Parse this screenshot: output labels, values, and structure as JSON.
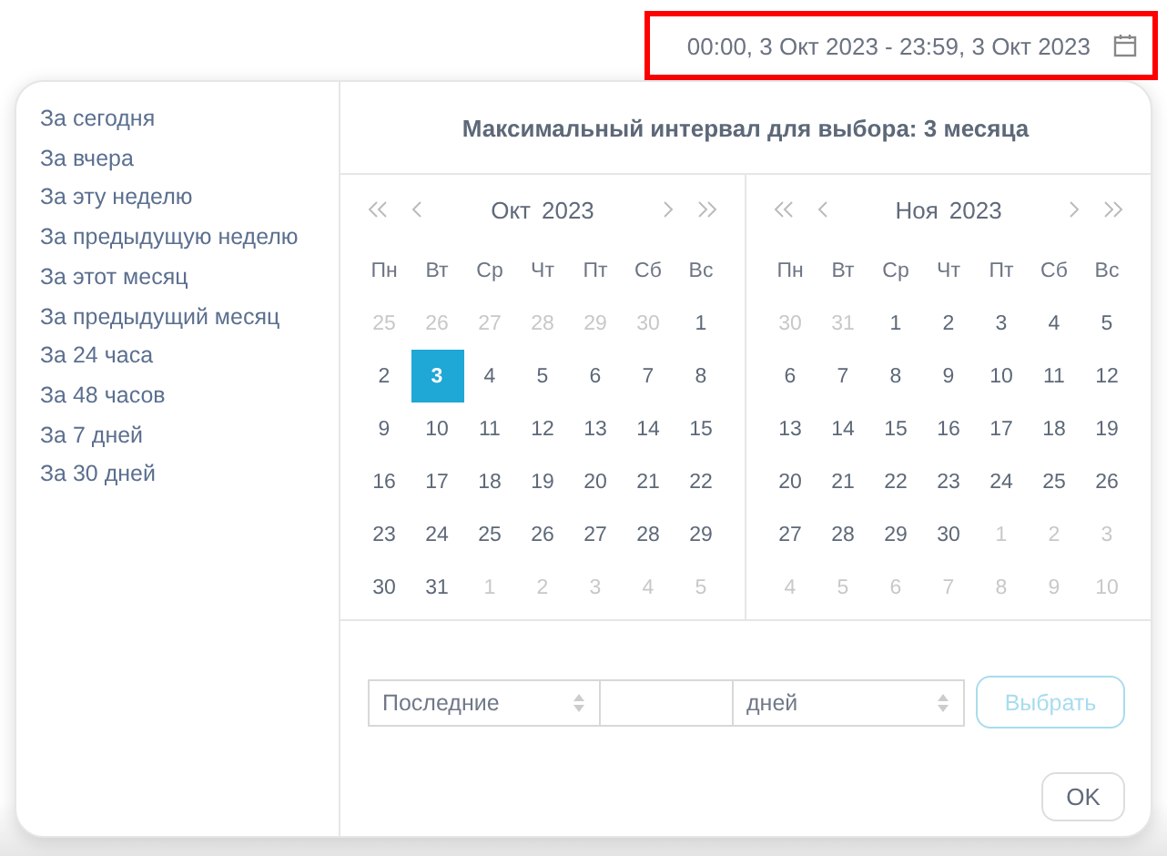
{
  "date_field": {
    "value": "00:00, 3 Окт 2023 - 23:59, 3 Окт 2023",
    "highlighted": true
  },
  "presets": [
    "За сегодня",
    "За вчера",
    "За эту неделю",
    "За предыдущую неделю",
    "За этот месяц",
    "За предыдущий месяц",
    "За 24 часа",
    "За 48 часов",
    "За 7 дней",
    "За 30 дней"
  ],
  "title": "Максимальный интервал для выбора: 3 месяца",
  "calendars": [
    {
      "month": "Окт",
      "year": "2023",
      "weekdays": [
        "Пн",
        "Вт",
        "Ср",
        "Чт",
        "Пт",
        "Сб",
        "Вс"
      ],
      "weeks": [
        [
          {
            "label": "25",
            "muted": true,
            "selected": false
          },
          {
            "label": "26",
            "muted": true,
            "selected": false
          },
          {
            "label": "27",
            "muted": true,
            "selected": false
          },
          {
            "label": "28",
            "muted": true,
            "selected": false
          },
          {
            "label": "29",
            "muted": true,
            "selected": false
          },
          {
            "label": "30",
            "muted": true,
            "selected": false
          },
          {
            "label": "1",
            "muted": false,
            "selected": false
          }
        ],
        [
          {
            "label": "2",
            "muted": false,
            "selected": false
          },
          {
            "label": "3",
            "muted": false,
            "selected": true
          },
          {
            "label": "4",
            "muted": false,
            "selected": false
          },
          {
            "label": "5",
            "muted": false,
            "selected": false
          },
          {
            "label": "6",
            "muted": false,
            "selected": false
          },
          {
            "label": "7",
            "muted": false,
            "selected": false
          },
          {
            "label": "8",
            "muted": false,
            "selected": false
          }
        ],
        [
          {
            "label": "9",
            "muted": false,
            "selected": false
          },
          {
            "label": "10",
            "muted": false,
            "selected": false
          },
          {
            "label": "11",
            "muted": false,
            "selected": false
          },
          {
            "label": "12",
            "muted": false,
            "selected": false
          },
          {
            "label": "13",
            "muted": false,
            "selected": false
          },
          {
            "label": "14",
            "muted": false,
            "selected": false
          },
          {
            "label": "15",
            "muted": false,
            "selected": false
          }
        ],
        [
          {
            "label": "16",
            "muted": false,
            "selected": false
          },
          {
            "label": "17",
            "muted": false,
            "selected": false
          },
          {
            "label": "18",
            "muted": false,
            "selected": false
          },
          {
            "label": "19",
            "muted": false,
            "selected": false
          },
          {
            "label": "20",
            "muted": false,
            "selected": false
          },
          {
            "label": "21",
            "muted": false,
            "selected": false
          },
          {
            "label": "22",
            "muted": false,
            "selected": false
          }
        ],
        [
          {
            "label": "23",
            "muted": false,
            "selected": false
          },
          {
            "label": "24",
            "muted": false,
            "selected": false
          },
          {
            "label": "25",
            "muted": false,
            "selected": false
          },
          {
            "label": "26",
            "muted": false,
            "selected": false
          },
          {
            "label": "27",
            "muted": false,
            "selected": false
          },
          {
            "label": "28",
            "muted": false,
            "selected": false
          },
          {
            "label": "29",
            "muted": false,
            "selected": false
          }
        ],
        [
          {
            "label": "30",
            "muted": false,
            "selected": false
          },
          {
            "label": "31",
            "muted": false,
            "selected": false
          },
          {
            "label": "1",
            "muted": true,
            "selected": false
          },
          {
            "label": "2",
            "muted": true,
            "selected": false
          },
          {
            "label": "3",
            "muted": true,
            "selected": false
          },
          {
            "label": "4",
            "muted": true,
            "selected": false
          },
          {
            "label": "5",
            "muted": true,
            "selected": false
          }
        ]
      ]
    },
    {
      "month": "Ноя",
      "year": "2023",
      "weekdays": [
        "Пн",
        "Вт",
        "Ср",
        "Чт",
        "Пт",
        "Сб",
        "Вс"
      ],
      "weeks": [
        [
          {
            "label": "30",
            "muted": true,
            "selected": false
          },
          {
            "label": "31",
            "muted": true,
            "selected": false
          },
          {
            "label": "1",
            "muted": false,
            "selected": false
          },
          {
            "label": "2",
            "muted": false,
            "selected": false
          },
          {
            "label": "3",
            "muted": false,
            "selected": false
          },
          {
            "label": "4",
            "muted": false,
            "selected": false
          },
          {
            "label": "5",
            "muted": false,
            "selected": false
          }
        ],
        [
          {
            "label": "6",
            "muted": false,
            "selected": false
          },
          {
            "label": "7",
            "muted": false,
            "selected": false
          },
          {
            "label": "8",
            "muted": false,
            "selected": false
          },
          {
            "label": "9",
            "muted": false,
            "selected": false
          },
          {
            "label": "10",
            "muted": false,
            "selected": false
          },
          {
            "label": "11",
            "muted": false,
            "selected": false
          },
          {
            "label": "12",
            "muted": false,
            "selected": false
          }
        ],
        [
          {
            "label": "13",
            "muted": false,
            "selected": false
          },
          {
            "label": "14",
            "muted": false,
            "selected": false
          },
          {
            "label": "15",
            "muted": false,
            "selected": false
          },
          {
            "label": "16",
            "muted": false,
            "selected": false
          },
          {
            "label": "17",
            "muted": false,
            "selected": false
          },
          {
            "label": "18",
            "muted": false,
            "selected": false
          },
          {
            "label": "19",
            "muted": false,
            "selected": false
          }
        ],
        [
          {
            "label": "20",
            "muted": false,
            "selected": false
          },
          {
            "label": "21",
            "muted": false,
            "selected": false
          },
          {
            "label": "22",
            "muted": false,
            "selected": false
          },
          {
            "label": "23",
            "muted": false,
            "selected": false
          },
          {
            "label": "24",
            "muted": false,
            "selected": false
          },
          {
            "label": "25",
            "muted": false,
            "selected": false
          },
          {
            "label": "26",
            "muted": false,
            "selected": false
          }
        ],
        [
          {
            "label": "27",
            "muted": false,
            "selected": false
          },
          {
            "label": "28",
            "muted": false,
            "selected": false
          },
          {
            "label": "29",
            "muted": false,
            "selected": false
          },
          {
            "label": "30",
            "muted": false,
            "selected": false
          },
          {
            "label": "1",
            "muted": true,
            "selected": false
          },
          {
            "label": "2",
            "muted": true,
            "selected": false
          },
          {
            "label": "3",
            "muted": true,
            "selected": false
          }
        ],
        [
          {
            "label": "4",
            "muted": true,
            "selected": false
          },
          {
            "label": "5",
            "muted": true,
            "selected": false
          },
          {
            "label": "6",
            "muted": true,
            "selected": false
          },
          {
            "label": "7",
            "muted": true,
            "selected": false
          },
          {
            "label": "8",
            "muted": true,
            "selected": false
          },
          {
            "label": "9",
            "muted": true,
            "selected": false
          },
          {
            "label": "10",
            "muted": true,
            "selected": false
          }
        ]
      ]
    }
  ],
  "range": {
    "mode": "Последние",
    "unit": "дней",
    "apply": "Выбрать",
    "apply_disabled": true
  },
  "ok": "OK"
}
